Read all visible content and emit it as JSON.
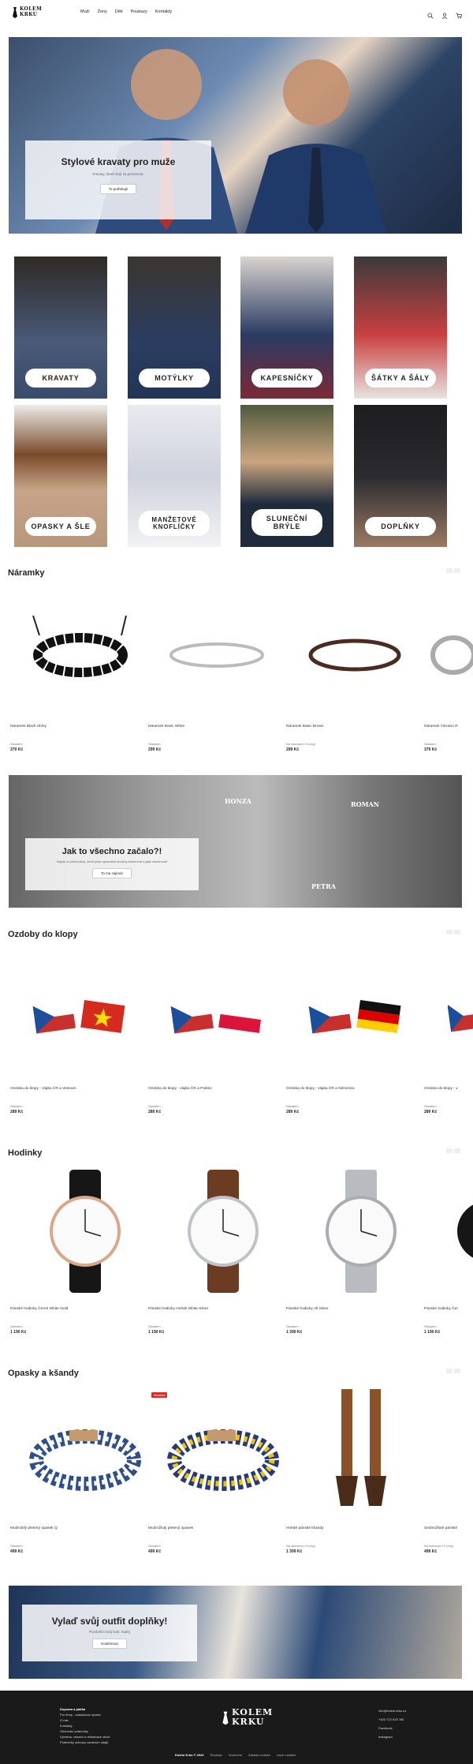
{
  "header": {
    "logo_line1": "KOLEM",
    "logo_line2": "KRKU",
    "nav": [
      "Muži",
      "Ženy",
      "Děti",
      "Poukazy",
      "Kontakty"
    ],
    "icons": [
      "search-icon",
      "user-icon",
      "cart-icon"
    ]
  },
  "hero": {
    "title": "Stylové kravaty pro muže",
    "subtitle": "Kravaty, které stojí za pozornost.",
    "button": "To potřebuji!"
  },
  "categories": [
    {
      "label": "KRAVATY"
    },
    {
      "label": "MOTÝLKY"
    },
    {
      "label": "KAPESNÍČKY"
    },
    {
      "label": "ŠÁTKY A ŠÁLY"
    },
    {
      "label": "OPASKY A ŠLE"
    },
    {
      "label": "MANŽETOVÉ KNOFLÍČKY"
    },
    {
      "label": "SLUNEČNÍ BRÝLE"
    },
    {
      "label": "DOPLŇKY"
    }
  ],
  "sections": {
    "naramky": {
      "title": "Náramky",
      "products": [
        {
          "name": "Náramek Black Shiny",
          "avail": "Skladem",
          "price": "379 Kč"
        },
        {
          "name": "Náramek Basic White",
          "avail": "Skladem",
          "price": "299 Kč"
        },
        {
          "name": "Náramek Basic Brown",
          "avail": "Na stanovení 5 (dny)",
          "price": "299 Kč"
        },
        {
          "name": "Náramek Volcano R",
          "avail": "Skladem",
          "price": "379 Kč"
        }
      ]
    },
    "story": {
      "title": "Jak to všechno začalo?!",
      "subtitle": "Nejste si předvolaný, ženě jsme opravdivě knowhy lektorovat a jaké zkušenosti",
      "button": "To ma zajimá!",
      "names": [
        "HONZA",
        "ROMAN",
        "PETRA"
      ]
    },
    "ozdoby": {
      "title": "Ozdoby do klopy",
      "products": [
        {
          "name": "Ozdoba do klopy - vlajka ČR a Vietnam",
          "avail": "Skladem",
          "price": "289 Kč"
        },
        {
          "name": "Ozdoba do klopy - vlajka ČR a Polsko",
          "avail": "Skladem",
          "price": "289 Kč"
        },
        {
          "name": "Ozdoba do klopy - vlajka ČR a Německo",
          "avail": "Skladem",
          "price": "289 Kč"
        },
        {
          "name": "Ozdoba do klopy - v",
          "avail": "Skladem",
          "price": "289 Kč"
        }
      ]
    },
    "hodinky": {
      "title": "Hodinky",
      "products": [
        {
          "name": "Pánské hodinky Černé White Gold",
          "avail": "Skladem",
          "price": "1 190 Kč"
        },
        {
          "name": "Pánské hodinky Hnědé White Silver",
          "avail": "Skladem",
          "price": "1 190 Kč"
        },
        {
          "name": "Pánské hodinky All Silver",
          "avail": "Skladem",
          "price": "1 390 Kč"
        },
        {
          "name": "Pánské hodinky Čer",
          "avail": "Skladem",
          "price": "1 190 Kč"
        }
      ]
    },
    "opasky": {
      "title": "Opasky a kšandy",
      "badge": "Novinka",
      "products": [
        {
          "name": "Modrobílý pletený opasek Q",
          "avail": "Skladem",
          "price": "499 Kč"
        },
        {
          "name": "Modrožlutý pletený opasek",
          "avail": "Skladem",
          "price": "499 Kč"
        },
        {
          "name": "Hnědé pánské kšandy",
          "avail": "Na stanovení 5 (dny)",
          "price": "1 399 Kč"
        },
        {
          "name": "Sedmožluté pánské",
          "avail": "Na stanovení 5 (dny)",
          "price": "499 Kč"
        }
      ]
    }
  },
  "cta": {
    "title": "Vylaď svůj outfit doplňky!",
    "subtitle": "Pozdvihni svůj look, hadej",
    "button": "Koukhnout"
  },
  "footer": {
    "links_left": [
      "Doprava a platba",
      "Pro firmy - zakázková výroba",
      "O nás",
      "Kontakty",
      "Obchodní podmínky",
      "Výměna, vrácení a reklamace zboží",
      "Podmínky ochrany osobních údajů"
    ],
    "logo_line1": "KOLEM",
    "logo_line2": "KRKU",
    "contact": [
      "info@kolem-krku.cz",
      "+420 722 019 780",
      "Facebook",
      "Instagram"
    ],
    "copyright": "Kolem Krku © 2024",
    "bottom_links": [
      "Shopsys",
      "Soukromí",
      "Zásady cookies",
      "Lepší cookies"
    ]
  },
  "colors": {
    "footer_bg": "#1a1a1a",
    "badge": "#d0302a"
  }
}
